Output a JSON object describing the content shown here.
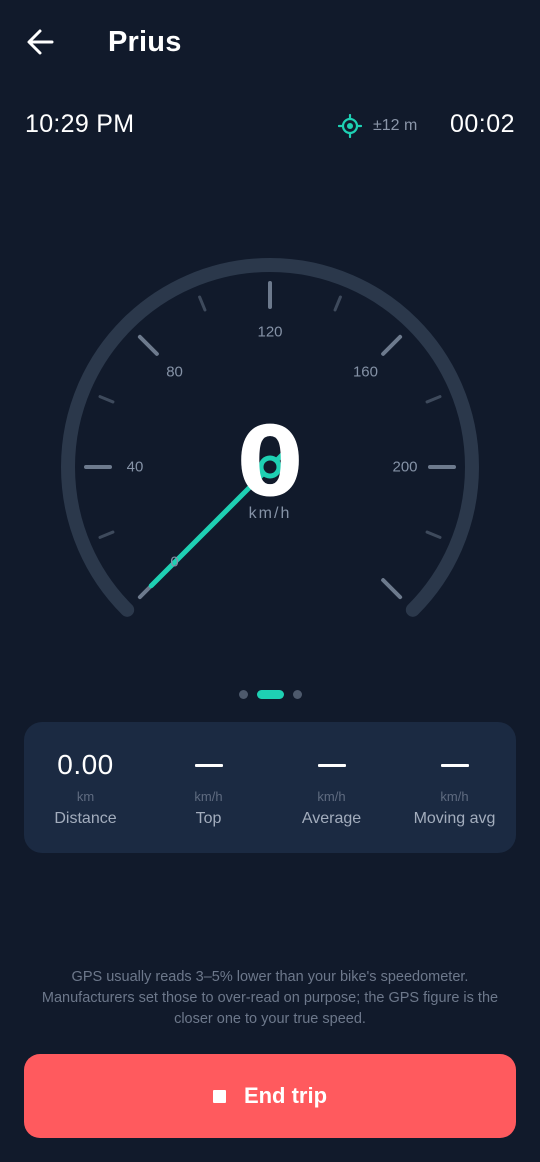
{
  "header": {
    "title": "Prius",
    "back_icon": "arrow-left-icon"
  },
  "status": {
    "time": "10:29 PM",
    "gps_accuracy": "±12 m",
    "elapsed": "00:02",
    "gps_icon": "location-crosshair-icon"
  },
  "gauge": {
    "speed": "0",
    "unit": "km/h",
    "max": 240,
    "current_speed_value": 0,
    "scale_labels": [
      "0",
      "40",
      "80",
      "120",
      "160",
      "200"
    ],
    "colors": {
      "accent": "#1ed0b3",
      "track": "#2b384b",
      "tick": "#5b6778"
    }
  },
  "pager": {
    "pages": 3,
    "active_index": 1
  },
  "stats": [
    {
      "value": "0.00",
      "unit": "km",
      "label": "Distance"
    },
    {
      "value": "—",
      "unit": "km/h",
      "label": "Top"
    },
    {
      "value": "—",
      "unit": "km/h",
      "label": "Average"
    },
    {
      "value": "—",
      "unit": "km/h",
      "label": "Moving avg"
    }
  ],
  "note": "GPS usually reads 3–5% lower than your bike's speedometer. Manufacturers set those to over-read on purpose; the GPS figure is the closer one to your true speed.",
  "end_trip": {
    "label": "End trip",
    "icon": "stop-icon",
    "color": "#ff5a5e"
  }
}
